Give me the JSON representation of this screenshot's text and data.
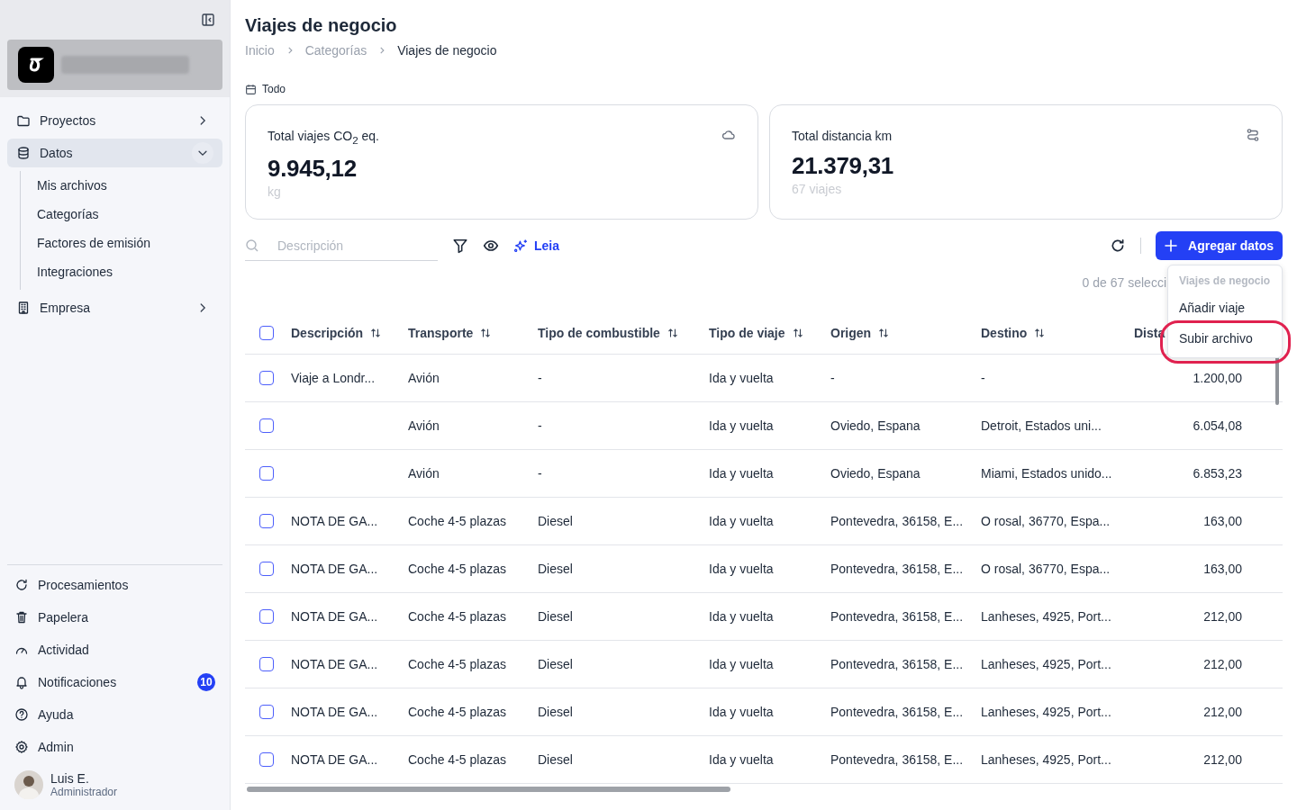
{
  "sidebar": {
    "nav": [
      {
        "label": "Proyectos",
        "kind": "folder",
        "expanded": false,
        "selected": false
      },
      {
        "label": "Datos",
        "kind": "database",
        "expanded": true,
        "selected": true,
        "children": [
          {
            "label": "Mis archivos"
          },
          {
            "label": "Categorías"
          },
          {
            "label": "Factores de emisión"
          },
          {
            "label": "Integraciones"
          }
        ]
      },
      {
        "label": "Empresa",
        "kind": "building",
        "expanded": false,
        "selected": false
      }
    ],
    "footer": [
      {
        "label": "Procesamientos",
        "kind": "refresh"
      },
      {
        "label": "Papelera",
        "kind": "trash"
      },
      {
        "label": "Actividad",
        "kind": "gauge"
      },
      {
        "label": "Notificaciones",
        "kind": "bell",
        "badge": "10"
      },
      {
        "label": "Ayuda",
        "kind": "help"
      },
      {
        "label": "Admin",
        "kind": "gear"
      }
    ],
    "user": {
      "name": "Luis E.",
      "role": "Administrador"
    }
  },
  "page": {
    "title": "Viajes de negocio",
    "breadcrumbs": [
      {
        "label": "Inicio",
        "selected": false
      },
      {
        "label": "Categorías",
        "selected": false
      },
      {
        "label": "Viajes de negocio",
        "selected": true
      }
    ],
    "period": "Todo"
  },
  "stats": [
    {
      "title": "Total viajes CO$_{2}$ eq.",
      "value": "9.945,12",
      "unit": "kg",
      "kind": "cloud"
    },
    {
      "title": "Total distancia km",
      "value": "21.379,31",
      "unit": "67 viajes",
      "kind": "route"
    }
  ],
  "toolbar": {
    "search": {
      "placeholder": "Descripción"
    },
    "assistant": "Leia",
    "add_button": "Agregar datos",
    "selection": "0 de 67 selecci"
  },
  "menu": {
    "heading": "Viajes de negocio",
    "items": [
      {
        "label": "Añadir viaje",
        "highlighted": false
      },
      {
        "label": "Subir archivo",
        "highlighted": true
      }
    ]
  },
  "table": {
    "all_checked": false,
    "columns": [
      {
        "label": "Descripción",
        "sortable": true
      },
      {
        "label": "Transporte",
        "sortable": true
      },
      {
        "label": "Tipo de combustible",
        "sortable": true
      },
      {
        "label": "Tipo de viaje",
        "sortable": true
      },
      {
        "label": "Origen",
        "sortable": true
      },
      {
        "label": "Destino",
        "sortable": true
      },
      {
        "label": "Dista"
      }
    ],
    "rows": [
      {
        "checked": false,
        "cells": [
          "Viaje a Londr...",
          "Avión",
          "-",
          "Ida y vuelta",
          "-",
          "-",
          "1.200,00"
        ]
      },
      {
        "checked": false,
        "cells": [
          "",
          "Avión",
          "-",
          "Ida y vuelta",
          "Oviedo, Espana",
          "Detroit, Estados uni...",
          "6.054,08"
        ]
      },
      {
        "checked": false,
        "cells": [
          "",
          "Avión",
          "-",
          "Ida y vuelta",
          "Oviedo, Espana",
          "Miami, Estados unido...",
          "6.853,23"
        ]
      },
      {
        "checked": false,
        "cells": [
          "NOTA DE GA...",
          "Coche 4-5 plazas",
          "Diesel",
          "Ida y vuelta",
          "Pontevedra, 36158, E...",
          "O rosal, 36770, Espa...",
          "163,00"
        ]
      },
      {
        "checked": false,
        "cells": [
          "NOTA DE GA...",
          "Coche 4-5 plazas",
          "Diesel",
          "Ida y vuelta",
          "Pontevedra, 36158, E...",
          "O rosal, 36770, Espa...",
          "163,00"
        ]
      },
      {
        "checked": false,
        "cells": [
          "NOTA DE GA...",
          "Coche 4-5 plazas",
          "Diesel",
          "Ida y vuelta",
          "Pontevedra, 36158, E...",
          "Lanheses, 4925, Port...",
          "212,00"
        ]
      },
      {
        "checked": false,
        "cells": [
          "NOTA DE GA...",
          "Coche 4-5 plazas",
          "Diesel",
          "Ida y vuelta",
          "Pontevedra, 36158, E...",
          "Lanheses, 4925, Port...",
          "212,00"
        ]
      },
      {
        "checked": false,
        "cells": [
          "NOTA DE GA...",
          "Coche 4-5 plazas",
          "Diesel",
          "Ida y vuelta",
          "Pontevedra, 36158, E...",
          "Lanheses, 4925, Port...",
          "212,00"
        ]
      },
      {
        "checked": false,
        "cells": [
          "NOTA DE GA...",
          "Coche 4-5 plazas",
          "Diesel",
          "Ida y vuelta",
          "Pontevedra, 36158, E...",
          "Lanheses, 4925, Port...",
          "212,00"
        ]
      }
    ]
  }
}
